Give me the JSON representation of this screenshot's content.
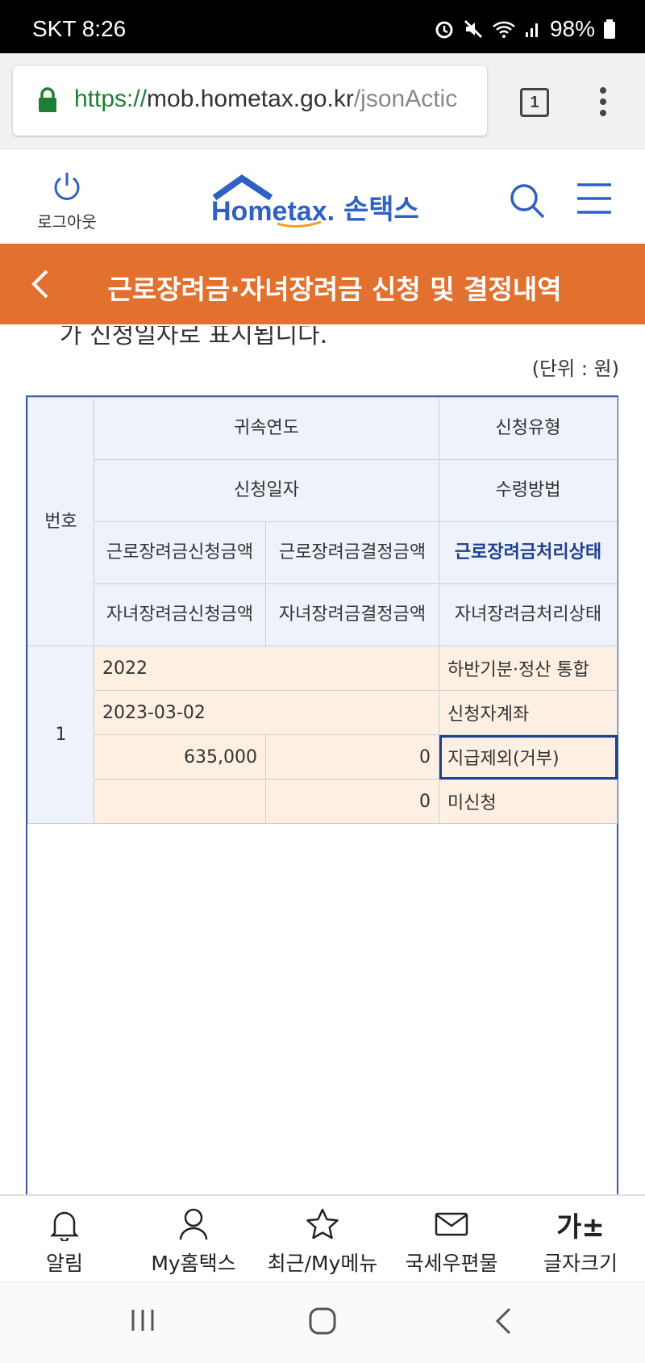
{
  "status_bar": {
    "carrier": "SKT",
    "time": "8:26",
    "battery": "98%"
  },
  "browser": {
    "url_scheme": "https://",
    "url_host": "mob.hometax.go.kr",
    "url_path": "/jsonActic",
    "tab_count": "1"
  },
  "header": {
    "logout_label": "로그아웃",
    "logo_text": "Hometax.",
    "logo_kor": "손택스"
  },
  "page_title": "근로장려금·자녀장려금 신청 및 결정내역",
  "cut_text": "가 신청일자로 표시됩니다.",
  "unit_label": "(단위 : 원)",
  "table": {
    "headers": {
      "no": "번호",
      "year": "귀속연도",
      "apply_type": "신청유형",
      "apply_date": "신청일자",
      "receive_method": "수령방법",
      "earned_apply_amount": "근로장려금신청금액",
      "earned_decided_amount": "근로장려금결정금액",
      "earned_status": "근로장려금처리상태",
      "child_apply_amount": "자녀장려금신청금액",
      "child_decided_amount": "자녀장려금결정금액",
      "child_status": "자녀장려금처리상태"
    },
    "rows": [
      {
        "no": "1",
        "year": "2022",
        "apply_type": "하반기분·정산 통합",
        "apply_date": "2023-03-02",
        "receive_method": "신청자계좌",
        "earned_apply_amount": "635,000",
        "earned_decided_amount": "0",
        "earned_status": "지급제외(거부)",
        "child_apply_amount": "",
        "child_decided_amount": "0",
        "child_status": "미신청"
      }
    ]
  },
  "bottom_nav": [
    {
      "label": "알림",
      "icon": "bell-icon"
    },
    {
      "label": "My홈택스",
      "icon": "person-icon"
    },
    {
      "label": "최근/My메뉴",
      "icon": "star-icon"
    },
    {
      "label": "국세우편물",
      "icon": "mail-icon"
    },
    {
      "label": "글자크기",
      "icon": "font-size-icon",
      "glyph": "가±"
    }
  ],
  "colors": {
    "title_bar": "#e2712f",
    "brand_blue": "#1f3f8f",
    "header_cell": "#eef3fb",
    "data_cell": "#fdf0e2"
  }
}
